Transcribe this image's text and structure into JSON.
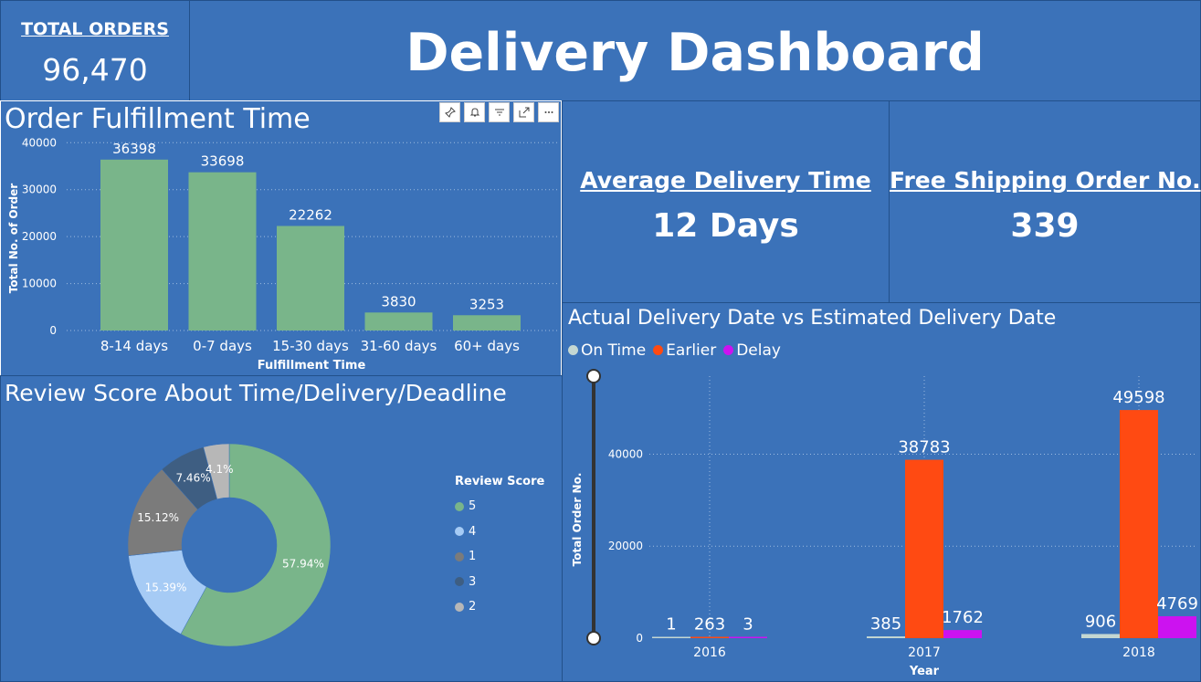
{
  "header": {
    "total_orders_label": "TOTAL ORDERS",
    "total_orders_value": "96,470",
    "title": "Delivery Dashboard"
  },
  "kpis": {
    "avg_delivery_label": "Average Delivery Time",
    "avg_delivery_value": "12 Days",
    "free_shipping_label": "Free Shipping Order No.",
    "free_shipping_value": "339"
  },
  "toolbar": {
    "icons": [
      "pin-icon",
      "bell-icon",
      "filter-icon",
      "focus-mode-icon",
      "more-options-icon"
    ]
  },
  "colors": {
    "background": "#3b72b9",
    "bar_green": "#79b58a",
    "on_time": "#c4d7d2",
    "earlier": "#ff4a12",
    "delay": "#cc12f0"
  },
  "fulfillment": {
    "title": "Order Fulfillment Time"
  },
  "review": {
    "title": "Review Score About Time/Delivery/Deadline",
    "legend_title": "Review Score"
  },
  "actual": {
    "title": "Actual Delivery Date vs Estimated Delivery Date"
  },
  "chart_data": [
    {
      "type": "bar",
      "title": "Order Fulfillment Time",
      "xlabel": "Fulfillment Time",
      "ylabel": "Total No. of Order",
      "categories": [
        "8-14 days",
        "0-7 days",
        "15-30 days",
        "31-60 days",
        "60+ days"
      ],
      "values": [
        36398,
        33698,
        22262,
        3830,
        3253
      ],
      "yticks": [
        0,
        10000,
        20000,
        30000,
        40000
      ],
      "ylim": [
        0,
        42000
      ],
      "grid": true,
      "color": "#79b58a"
    },
    {
      "type": "pie",
      "title": "Review Score About Time/Delivery/Deadline",
      "legend_title": "Review Score",
      "labels": [
        "5",
        "4",
        "1",
        "3",
        "2"
      ],
      "values": [
        57.94,
        15.39,
        15.12,
        7.46,
        4.1
      ],
      "display_labels": [
        "57.94%",
        "15.39%",
        "15.12%",
        "7.46%",
        "4.1%"
      ],
      "colors": [
        "#79b58a",
        "#a6cbf5",
        "#7b7b7b",
        "#3e5e82",
        "#b7b7b7"
      ],
      "legend_position": "right"
    },
    {
      "type": "bar",
      "title": "Actual Delivery Date vs Estimated Delivery Date",
      "xlabel": "Year",
      "ylabel": "Total Order No.",
      "categories": [
        "2016",
        "2017",
        "2018"
      ],
      "series": [
        {
          "name": "On Time",
          "values": [
            1,
            385,
            906
          ],
          "color": "#c4d7d2"
        },
        {
          "name": "Earlier",
          "values": [
            263,
            38783,
            49598
          ],
          "color": "#ff4a12"
        },
        {
          "name": "Delay",
          "values": [
            3,
            1762,
            4769
          ],
          "color": "#cc12f0"
        }
      ],
      "yticks": [
        0,
        20000,
        40000
      ],
      "ylim": [
        0,
        52000
      ],
      "grid": true,
      "legend_position": "top-left"
    }
  ]
}
